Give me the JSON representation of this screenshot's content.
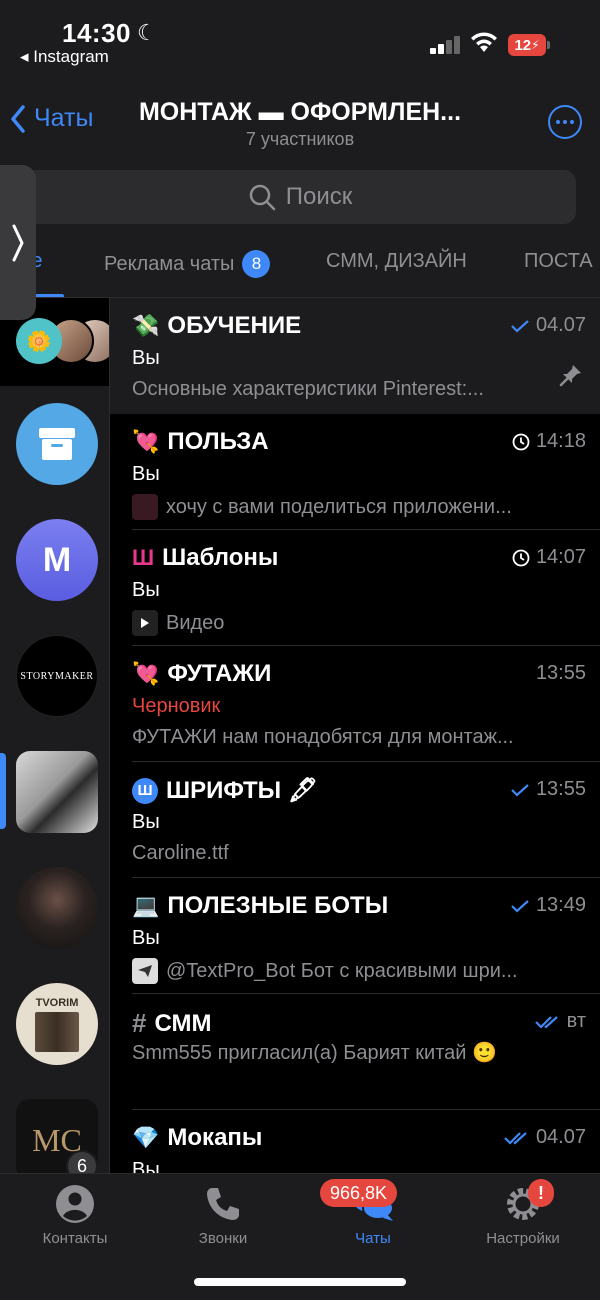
{
  "status_bar": {
    "time": "14:30",
    "back_app": "◂ Instagram",
    "battery": "12"
  },
  "header": {
    "back_label": "Чаты",
    "title": "МОНТАЖ ▬ ОФОРМЛЕН...",
    "subtitle": "7 участников"
  },
  "search": {
    "placeholder": "Поиск"
  },
  "tabs": [
    {
      "label": "Все",
      "active": true
    },
    {
      "label": "Реклама чаты",
      "badge": "8"
    },
    {
      "label": "СММ, ДИЗАЙН"
    },
    {
      "label": "ПОСТА"
    }
  ],
  "side_avatars": [
    {
      "name": "group-avatars"
    },
    {
      "name": "archive-icon"
    },
    {
      "name": "m-avatar",
      "letter": "M"
    },
    {
      "name": "storymaker-avatar",
      "text": "STORYMAKER"
    },
    {
      "name": "laptop-avatar"
    },
    {
      "name": "girl-avatar"
    },
    {
      "name": "tvorim-avatar",
      "text": "TVORIM"
    },
    {
      "name": "mc-avatar",
      "text": "MC",
      "badge": "6"
    }
  ],
  "chats": [
    {
      "emoji": "💸",
      "name": "ОБУЧЕНИЕ",
      "time": "04.07",
      "status": "read-single",
      "sender": "Вы",
      "preview": "Основные характеристики Pinterest:...",
      "pinned": true
    },
    {
      "emoji": "💘",
      "name": "ПОЛЬЗА",
      "time": "14:18",
      "status": "clock",
      "sender": "Вы",
      "preview": "хочу с вами поделиться приложени...",
      "thumb": "image"
    },
    {
      "emoji": "Ш",
      "name": "Шаблоны",
      "time": "14:07",
      "status": "clock",
      "sender": "Вы",
      "preview": "Видео",
      "thumb": "video"
    },
    {
      "emoji": "💘",
      "name": "ФУТАЖИ",
      "time": "13:55",
      "status": "none",
      "sender": "Черновик",
      "draft": true,
      "preview": "ФУТАЖИ нам понадобятся для монтаж..."
    },
    {
      "emoji": "Ш",
      "name": "ШРИФТЫ 🖋",
      "time": "13:55",
      "status": "read-single",
      "sender": "Вы",
      "preview": "Caroline.ttf"
    },
    {
      "emoji": "💻",
      "name": "ПОЛЕЗНЫЕ БОТЫ",
      "time": "13:49",
      "status": "read-single",
      "sender": "Вы",
      "preview": "@TextPro_Bot Бот с красивыми шри...",
      "thumb": "bot"
    },
    {
      "emoji": "#",
      "name": "СММ",
      "time": "вт",
      "status": "read-double",
      "sender": "",
      "preview": "Smm555 пригласил(а) Барият китай 🙂"
    },
    {
      "emoji": "💎",
      "name": "Мокапы",
      "time": "04.07",
      "status": "read-double",
      "sender": "Вы",
      "preview": ""
    }
  ],
  "tabbar": {
    "items": [
      {
        "label": "Контакты"
      },
      {
        "label": "Звонки"
      },
      {
        "label": "Чаты",
        "badge": "966,8K",
        "active": true
      },
      {
        "label": "Настройки",
        "badge": "!"
      }
    ]
  },
  "colors": {
    "accent": "#3e88f7",
    "red": "#e5473e",
    "bg": "#000000",
    "panel": "#1c1c1e"
  }
}
